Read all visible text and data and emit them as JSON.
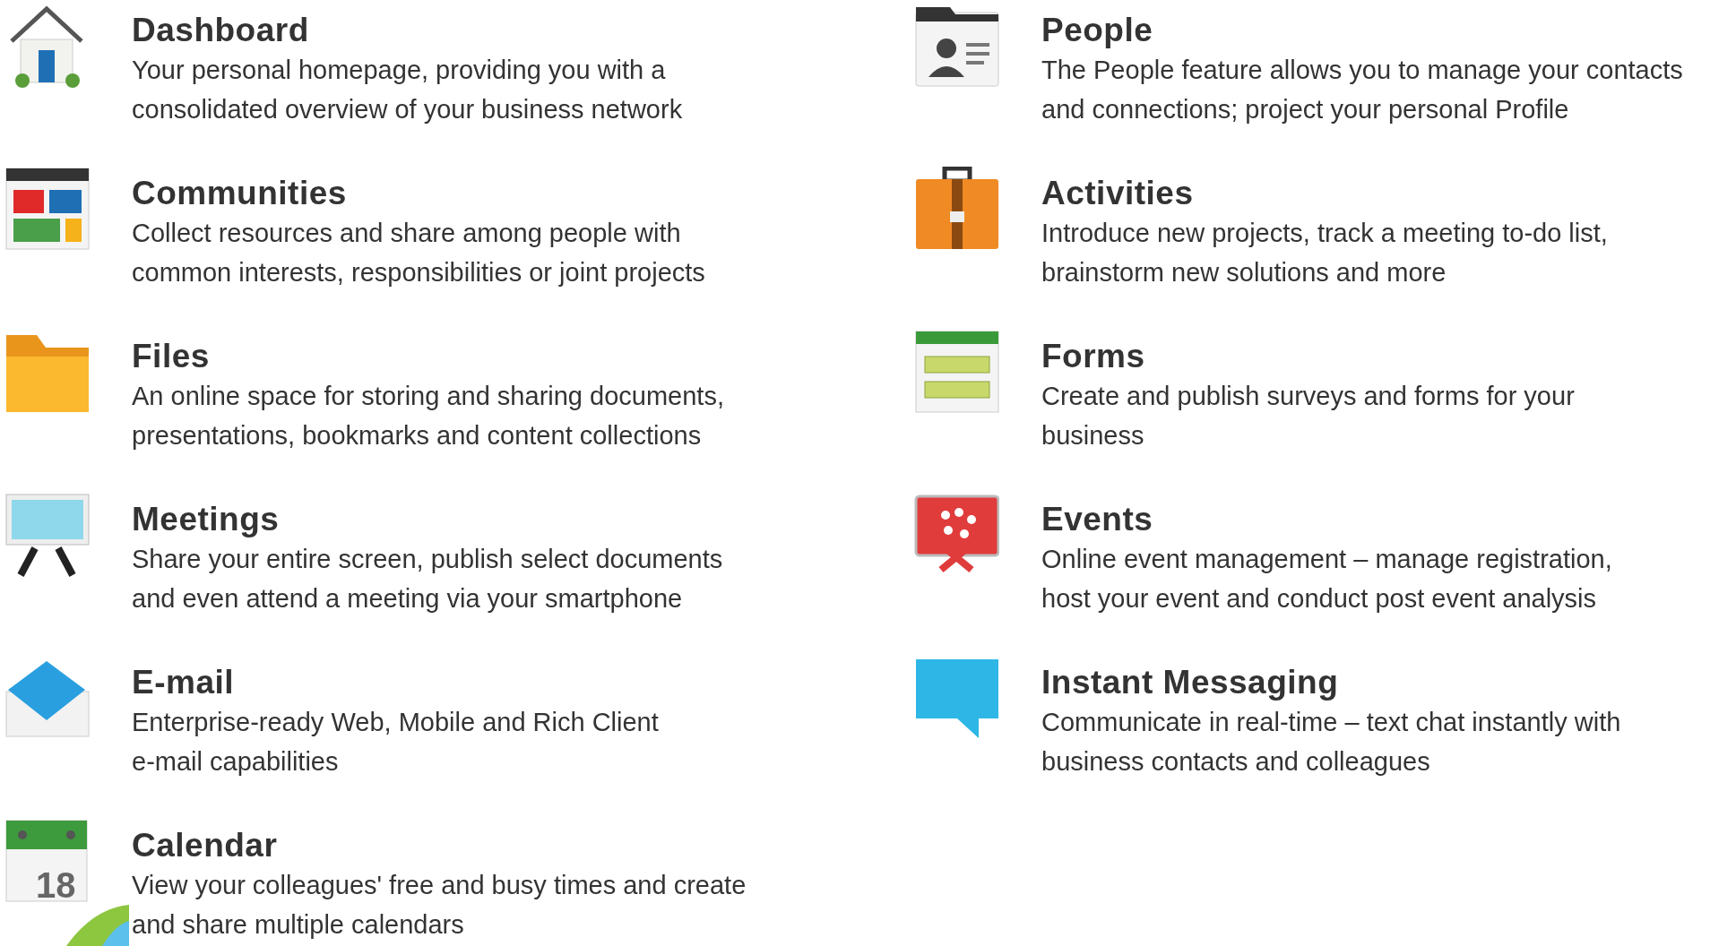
{
  "features": [
    {
      "title": "Dashboard",
      "description": "Your personal homepage, providing you with a\nconsolidated overview of your business network"
    },
    {
      "title": "People",
      "description": "The People feature allows you to manage your contacts\nand connections; project your personal Profile"
    },
    {
      "title": "Communities",
      "description": "Collect resources and share among people with\ncommon interests, responsibilities or joint projects"
    },
    {
      "title": "Activities",
      "description": "Introduce new projects, track a meeting to-do list,\nbrainstorm new solutions and more"
    },
    {
      "title": "Files",
      "description": "An online space for storing and sharing documents,\npresentations, bookmarks and content collections"
    },
    {
      "title": "Forms",
      "description": "Create and publish surveys and forms for your\nbusiness"
    },
    {
      "title": "Meetings",
      "description": "Share your entire screen, publish select documents\nand even attend a meeting via your smartphone"
    },
    {
      "title": "Events",
      "description": "Online event management – manage registration,\nhost your event and conduct post event analysis"
    },
    {
      "title": "E-mail",
      "description": "Enterprise-ready Web, Mobile and Rich Client\ne-mail capabilities"
    },
    {
      "title": "Instant Messaging",
      "description": "Communicate in real-time – text chat instantly with\nbusiness contacts and colleagues"
    },
    {
      "title": "Calendar",
      "description": "View your colleagues' free and busy times and create\nand share multiple calendars",
      "day": "18"
    }
  ]
}
